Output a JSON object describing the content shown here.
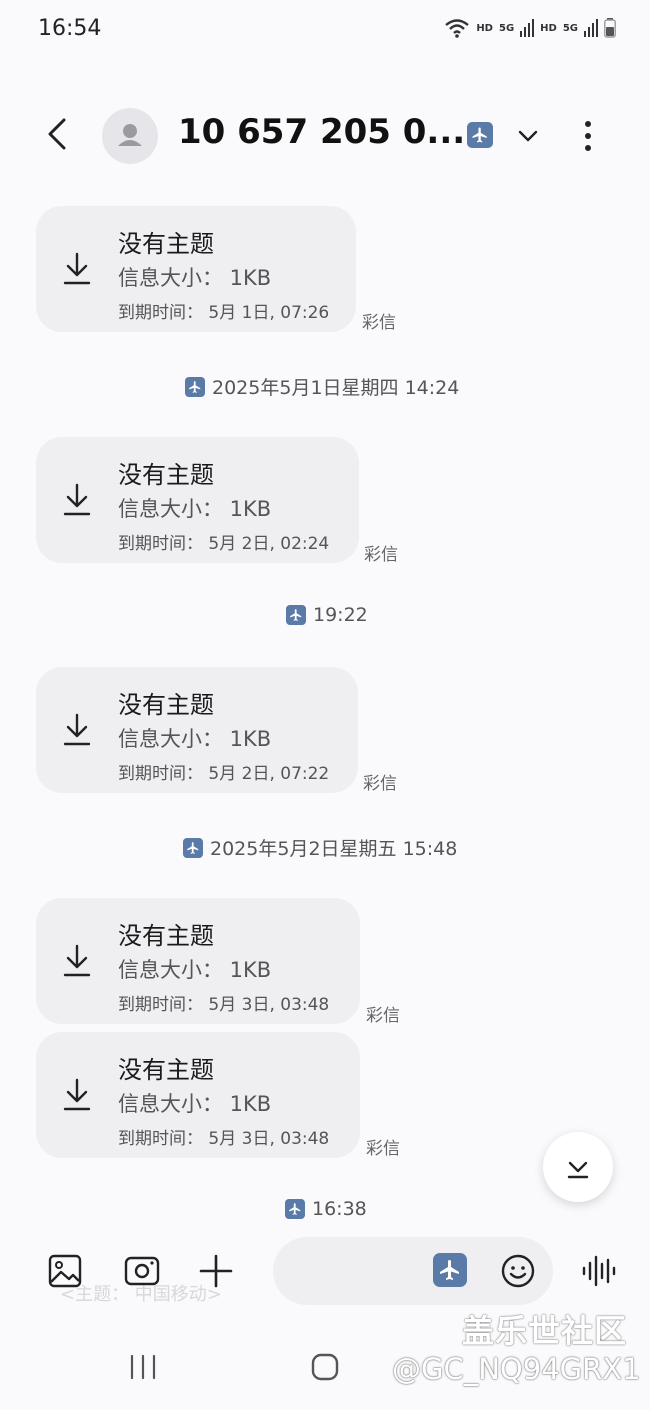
{
  "status_bar": {
    "time": "16:54",
    "signal_labels": [
      "HD",
      "5G",
      "HD",
      "5G"
    ]
  },
  "header": {
    "title": "10 657 205 0..."
  },
  "messages": [
    {
      "subject": "没有主题",
      "size": "信息大小： 1KB",
      "expiry": "到期时间： 5月 1日, 07:26",
      "type": "彩信"
    },
    {
      "subject": "没有主题",
      "size": "信息大小： 1KB",
      "expiry": "到期时间： 5月 2日, 02:24",
      "type": "彩信"
    },
    {
      "subject": "没有主题",
      "size": "信息大小： 1KB",
      "expiry": "到期时间： 5月 2日, 07:22",
      "type": "彩信"
    },
    {
      "subject": "没有主题",
      "size": "信息大小： 1KB",
      "expiry": "到期时间： 5月 3日, 03:48",
      "type": "彩信"
    },
    {
      "subject": "没有主题",
      "size": "信息大小： 1KB",
      "expiry": "到期时间： 5月 3日, 03:48",
      "type": "彩信"
    }
  ],
  "date_separators": [
    "2025年5月1日星期四 14:24",
    "19:22",
    "2025年5月2日星期五 15:48",
    "16:38"
  ],
  "composer": {
    "faint_text": "<主题： 中国移动>"
  },
  "watermark": {
    "line1": "盖乐世社区",
    "line2": "@GC_NQ94GRX1"
  },
  "icons": [
    "back-arrow-icon",
    "contact-avatar-icon",
    "airplane-icon",
    "chevron-down-icon",
    "more-vert-icon",
    "download-icon",
    "gallery-icon",
    "camera-icon",
    "plus-icon",
    "emoji-icon",
    "voice-icon",
    "recent-apps-icon",
    "home-icon"
  ],
  "colors": {
    "accent": "#5a7aa8",
    "bubble": "#efeff2",
    "background": "#fafafd"
  }
}
